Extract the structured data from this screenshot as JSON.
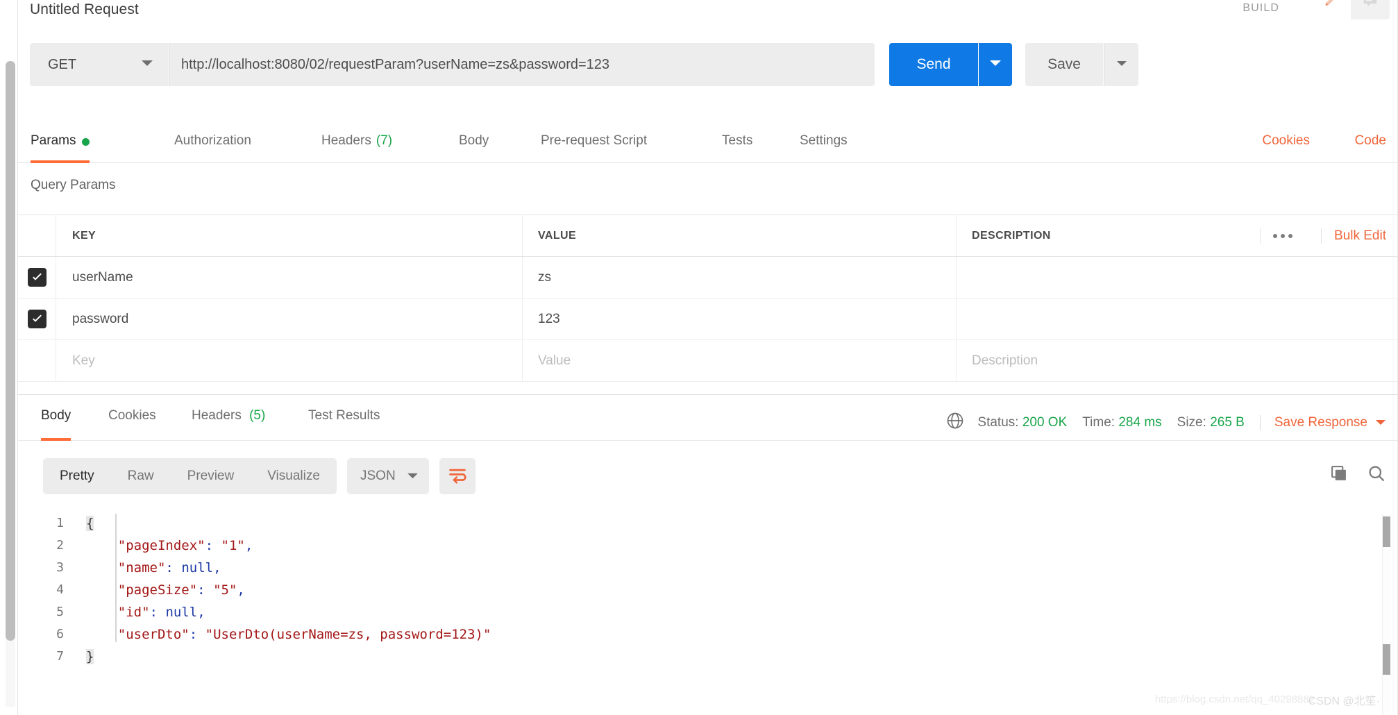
{
  "window": {
    "request_title": "Untitled Request",
    "build_label": "BUILD"
  },
  "icons": {
    "pencil": "pencil-icon",
    "comment": "comment-icon",
    "globe": "globe-icon",
    "copy": "copy-icon",
    "search": "search-icon",
    "wrap": "word-wrap-icon"
  },
  "url_bar": {
    "method": "GET",
    "url": "http://localhost:8080/02/requestParam?userName=zs&password=123",
    "send_label": "Send",
    "save_label": "Save"
  },
  "request_tabs": [
    {
      "label": "Params",
      "active": true,
      "dot": true,
      "count": ""
    },
    {
      "label": "Authorization",
      "active": false,
      "dot": false,
      "count": ""
    },
    {
      "label": "Headers",
      "active": false,
      "dot": false,
      "count": "(7)"
    },
    {
      "label": "Body",
      "active": false,
      "dot": false,
      "count": ""
    },
    {
      "label": "Pre-request Script",
      "active": false,
      "dot": false,
      "count": ""
    },
    {
      "label": "Tests",
      "active": false,
      "dot": false,
      "count": ""
    },
    {
      "label": "Settings",
      "active": false,
      "dot": false,
      "count": ""
    }
  ],
  "request_tab_links": {
    "cookies": "Cookies",
    "code": "Code"
  },
  "query_params": {
    "section_label": "Query Params",
    "columns": [
      "KEY",
      "VALUE",
      "DESCRIPTION"
    ],
    "bulk_edit_label": "Bulk Edit",
    "rows": [
      {
        "checked": true,
        "key": "userName",
        "value": "zs",
        "description": ""
      },
      {
        "checked": true,
        "key": "password",
        "value": "123",
        "description": ""
      }
    ],
    "placeholders": {
      "key": "Key",
      "value": "Value",
      "description": "Description"
    }
  },
  "response_tabs": [
    {
      "label": "Body",
      "active": true,
      "count": ""
    },
    {
      "label": "Cookies",
      "active": false,
      "count": ""
    },
    {
      "label": "Headers",
      "active": false,
      "count": "(5)"
    },
    {
      "label": "Test Results",
      "active": false,
      "count": ""
    }
  ],
  "response_meta": {
    "status_label": "Status:",
    "status_value": "200 OK",
    "time_label": "Time:",
    "time_value": "284 ms",
    "size_label": "Size:",
    "size_value": "265 B",
    "save_response_label": "Save Response"
  },
  "viewer": {
    "modes": [
      {
        "label": "Pretty",
        "active": true
      },
      {
        "label": "Raw",
        "active": false
      },
      {
        "label": "Preview",
        "active": false
      },
      {
        "label": "Visualize",
        "active": false
      }
    ],
    "format": "JSON"
  },
  "response_body": {
    "line_numbers": [
      "1",
      "2",
      "3",
      "4",
      "5",
      "6",
      "7"
    ],
    "lines": [
      [
        {
          "t": "{",
          "c": "brace-hl"
        }
      ],
      [
        {
          "t": "    ",
          "c": "b"
        },
        {
          "t": "\"pageIndex\"",
          "c": "k"
        },
        {
          "t": ":",
          "c": "p"
        },
        {
          "t": " ",
          "c": "b"
        },
        {
          "t": "\"1\"",
          "c": "s"
        },
        {
          "t": ",",
          "c": "p"
        }
      ],
      [
        {
          "t": "    ",
          "c": "b"
        },
        {
          "t": "\"name\"",
          "c": "k"
        },
        {
          "t": ":",
          "c": "p"
        },
        {
          "t": " ",
          "c": "b"
        },
        {
          "t": "null",
          "c": "n"
        },
        {
          "t": ",",
          "c": "p"
        }
      ],
      [
        {
          "t": "    ",
          "c": "b"
        },
        {
          "t": "\"pageSize\"",
          "c": "k"
        },
        {
          "t": ":",
          "c": "p"
        },
        {
          "t": " ",
          "c": "b"
        },
        {
          "t": "\"5\"",
          "c": "s"
        },
        {
          "t": ",",
          "c": "p"
        }
      ],
      [
        {
          "t": "    ",
          "c": "b"
        },
        {
          "t": "\"id\"",
          "c": "k"
        },
        {
          "t": ":",
          "c": "p"
        },
        {
          "t": " ",
          "c": "b"
        },
        {
          "t": "null",
          "c": "n"
        },
        {
          "t": ",",
          "c": "p"
        }
      ],
      [
        {
          "t": "    ",
          "c": "b"
        },
        {
          "t": "\"userDto\"",
          "c": "k"
        },
        {
          "t": ":",
          "c": "p"
        },
        {
          "t": " ",
          "c": "b"
        },
        {
          "t": "\"UserDto(userName=zs, password=123)\"",
          "c": "s"
        }
      ],
      [
        {
          "t": "}",
          "c": "brace-hl"
        }
      ]
    ],
    "raw_text": "{\n    \"pageIndex\": \"1\",\n    \"name\": null,\n    \"pageSize\": \"5\",\n    \"id\": null,\n    \"userDto\": \"UserDto(userName=zs, password=123)\"\n}"
  },
  "watermark": {
    "url": "https://blog.csdn.net/qq_40298882",
    "credit": "CSDN @北笙·"
  },
  "colors": {
    "accent_orange": "#ff6c37",
    "link_orange": "#f0663a",
    "send_blue": "#0f7ae5",
    "status_green": "#19a54a",
    "json_key_red": "#a31515",
    "json_null_blue": "#1f3aa5"
  }
}
